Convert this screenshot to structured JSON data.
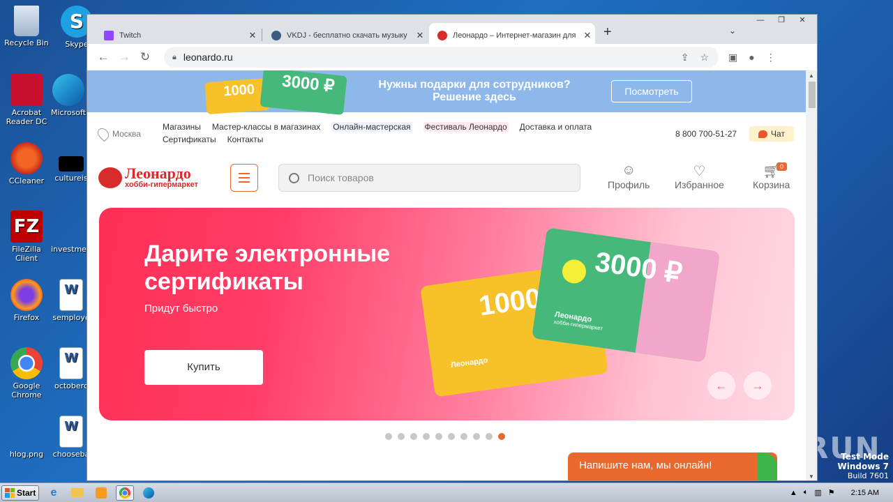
{
  "desktop": {
    "icons": [
      {
        "label": "Recycle Bin",
        "icon": "recycle-bin-icon"
      },
      {
        "label": "Skype",
        "icon": "skype-icon"
      },
      {
        "label": "Acrobat Reader DC",
        "icon": "acrobat-icon"
      },
      {
        "label": "Microsoft",
        "icon": "edge-icon"
      },
      {
        "label": "CCleaner",
        "icon": "ccleaner-icon"
      },
      {
        "label": "cultureis",
        "icon": "file-icon"
      },
      {
        "label": "FileZilla Client",
        "icon": "filezilla-icon"
      },
      {
        "label": "investmen",
        "icon": "file-icon"
      },
      {
        "label": "Firefox",
        "icon": "firefox-icon"
      },
      {
        "label": "semploye",
        "icon": "word-doc-icon"
      },
      {
        "label": "Google Chrome",
        "icon": "chrome-icon"
      },
      {
        "label": "octoberc",
        "icon": "word-doc-icon"
      },
      {
        "label": "hlog.png",
        "icon": "image-file-icon"
      },
      {
        "label": "chooseba",
        "icon": "word-doc-icon"
      }
    ],
    "watermark": "ANY.RUN",
    "test_mode": {
      "line1": "Test Mode",
      "line2": "Windows 7",
      "line3": "Build 7601"
    }
  },
  "taskbar": {
    "start_label": "Start",
    "clock": "2:15 AM"
  },
  "browser": {
    "tabs": [
      {
        "title": "Twitch",
        "icon": "twitch-icon"
      },
      {
        "title": "VKDJ - бесплатно скачать музыку",
        "icon": "vkdj-icon"
      },
      {
        "title": "Леонардо – Интернет-магазин для",
        "icon": "leonardo-favicon-icon"
      }
    ],
    "url": "leonardo.ru"
  },
  "page": {
    "promo": {
      "text_line1": "Нужны подарки для сотрудников?",
      "text_line2": "Решение здесь",
      "button": "Посмотреть",
      "card_amount_small": "1000",
      "card_amount_big": "3000 ₽"
    },
    "topnav": {
      "city": "Москва",
      "links_row1": [
        "Магазины",
        "Мастер-классы в магазинах",
        "Онлайн-мастерская",
        "Фестиваль Леонардо",
        "Доставка и оплата"
      ],
      "links_row2": [
        "Сертификаты",
        "Контакты"
      ],
      "phone": "8 800 700-51-27",
      "chat": "Чат"
    },
    "header": {
      "logo_name": "Леонардо",
      "logo_sub": "хобби-гипермаркет",
      "search_placeholder": "Поиск товаров",
      "profile": "Профиль",
      "favorites": "Избранное",
      "cart": "Корзина",
      "cart_count": "0"
    },
    "banner": {
      "title_line1": "Дарите электронные",
      "title_line2": "сертификаты",
      "subtitle": "Придут быстро",
      "button": "Купить",
      "card1_amount": "1000",
      "card2_amount": "3000 ₽",
      "card_logo": "Леонардо",
      "card_logo_sub": "хобби-гипермаркет",
      "slides_total": 10,
      "active_slide": 10
    },
    "chat_popup": "Напишите нам, мы онлайн!"
  }
}
